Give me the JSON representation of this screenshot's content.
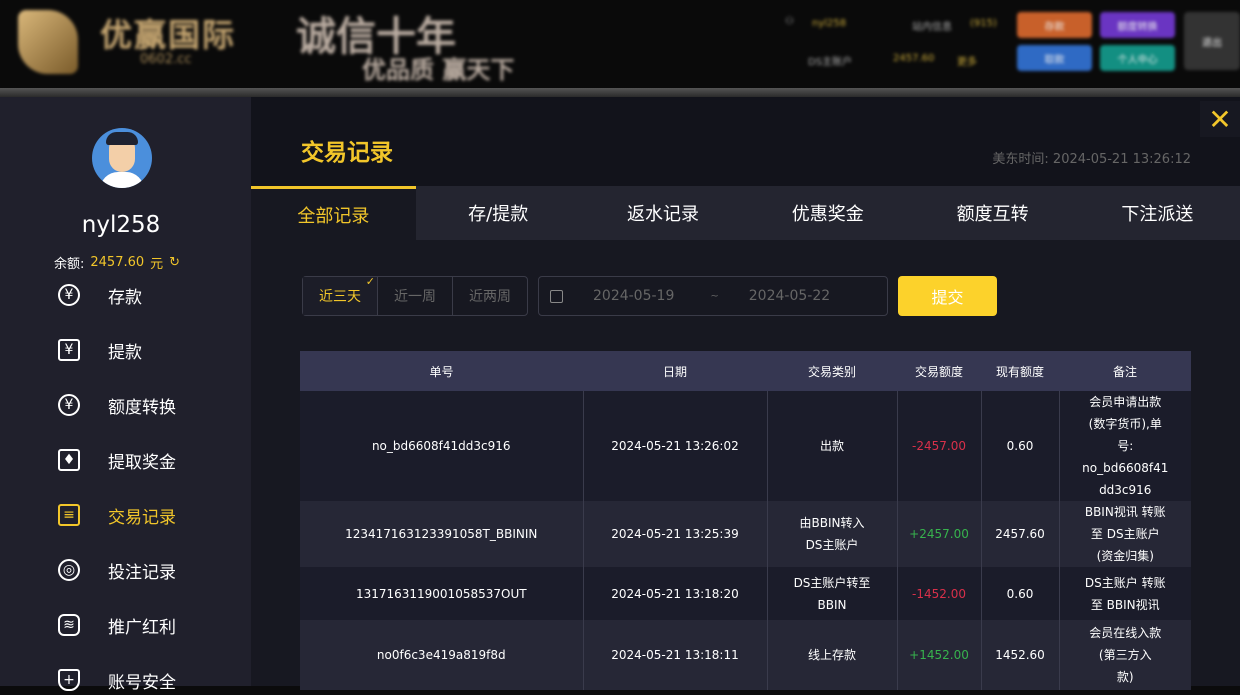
{
  "topbar": {
    "brand": "优赢国际",
    "domain": "0602.cc",
    "slogan1": "诚信十年",
    "slogan2": "优品质 赢天下",
    "user": "nyl258",
    "messages": "站内信息",
    "msg_count": "(915)",
    "account_label": "DS主账户",
    "account_balance": "2457.60",
    "more": "更多",
    "buttons": {
      "deposit": "存款",
      "transfer": "额度转换",
      "withdraw": "取款",
      "profile": "个人中心",
      "logout": "退出"
    }
  },
  "sidebar": {
    "username": "nyl258",
    "balance_label": "余额:",
    "balance": "2457.60",
    "currency": "元",
    "items": [
      {
        "label": "存款",
        "icon": "¥"
      },
      {
        "label": "提款",
        "icon": "¥"
      },
      {
        "label": "额度转换",
        "icon": "¥"
      },
      {
        "label": "提取奖金",
        "icon": "♦"
      },
      {
        "label": "交易记录",
        "icon": "≡"
      },
      {
        "label": "投注记录",
        "icon": "◎"
      },
      {
        "label": "推广红利",
        "icon": "≋"
      },
      {
        "label": "账号安全",
        "icon": "+"
      }
    ]
  },
  "main": {
    "title": "交易记录",
    "time": "美东时间: 2024-05-21 13:26:12",
    "tabs": [
      "全部记录",
      "存/提款",
      "返水记录",
      "优惠奖金",
      "额度互转",
      "下注派送"
    ],
    "ranges": [
      "近三天",
      "近一周",
      "近两周"
    ],
    "start_date": "2024-05-19",
    "date_sep": "~",
    "end_date": "2024-05-22",
    "submit": "提交"
  },
  "table": {
    "headers": [
      "单号",
      "日期",
      "交易类别",
      "交易额度",
      "现有额度",
      "备注"
    ],
    "rows": [
      {
        "id": "no_bd6608f41dd3c916",
        "date": "2024-05-21 13:26:02",
        "type": [
          "出款"
        ],
        "amount": "-2457.00",
        "balance": "0.60",
        "remark": [
          "会员申请出款",
          "(数字货币),单",
          "号:",
          "no_bd6608f41",
          "dd3c916"
        ]
      },
      {
        "id": "123417163123391058T_BBININ",
        "date": "2024-05-21 13:25:39",
        "type": [
          "由BBIN转入",
          "DS主账户"
        ],
        "amount": "+2457.00",
        "balance": "2457.60",
        "remark": [
          "BBIN视讯 转账",
          "至 DS主账户",
          "(资金归集)"
        ]
      },
      {
        "id": "1317163119001058537OUT",
        "date": "2024-05-21 13:18:20",
        "type": [
          "DS主账户转至",
          "BBIN"
        ],
        "amount": "-1452.00",
        "balance": "0.60",
        "remark": [
          "DS主账户 转账",
          "至 BBIN视讯"
        ]
      },
      {
        "id": "no0f6c3e419a819f8d",
        "date": "2024-05-21 13:18:11",
        "type": [
          "线上存款"
        ],
        "amount": "+1452.00",
        "balance": "1452.60",
        "remark": [
          "会员在线入款",
          "(第三方入",
          "款)"
        ]
      }
    ]
  },
  "colors": {
    "accent": "#f2c62a",
    "negative": "#d8304a",
    "positive": "#37b24d"
  }
}
